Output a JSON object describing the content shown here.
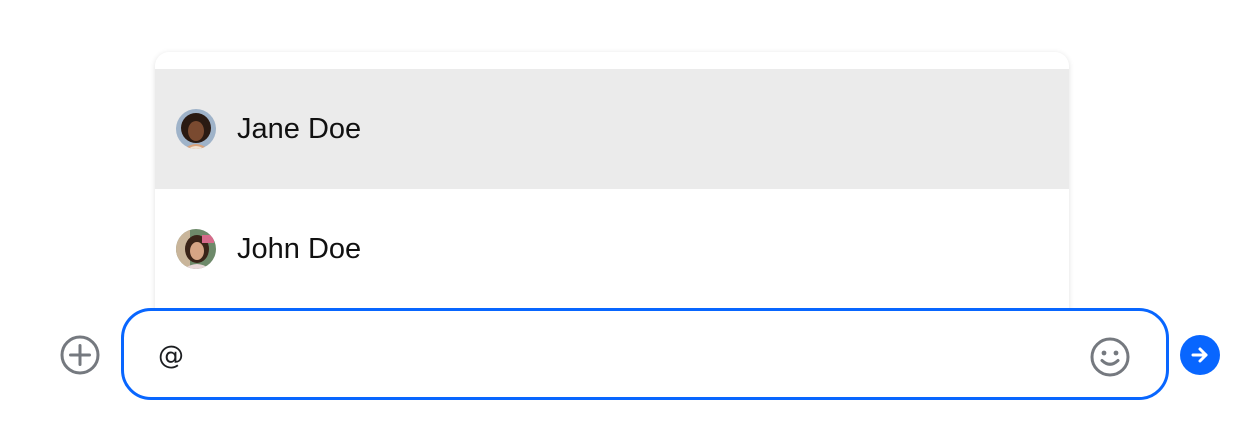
{
  "mentions": {
    "items": [
      {
        "name": "Jane Doe",
        "highlighted": true
      },
      {
        "name": "John Doe",
        "highlighted": false
      }
    ]
  },
  "composer": {
    "text": "@"
  },
  "icons": {
    "add": "plus-circle-icon",
    "emoji": "smiley-icon",
    "send": "arrow-right-icon"
  },
  "colors": {
    "accent": "#0866ff",
    "highlight_row": "#ebebeb",
    "icon_gray": "#75797f"
  }
}
